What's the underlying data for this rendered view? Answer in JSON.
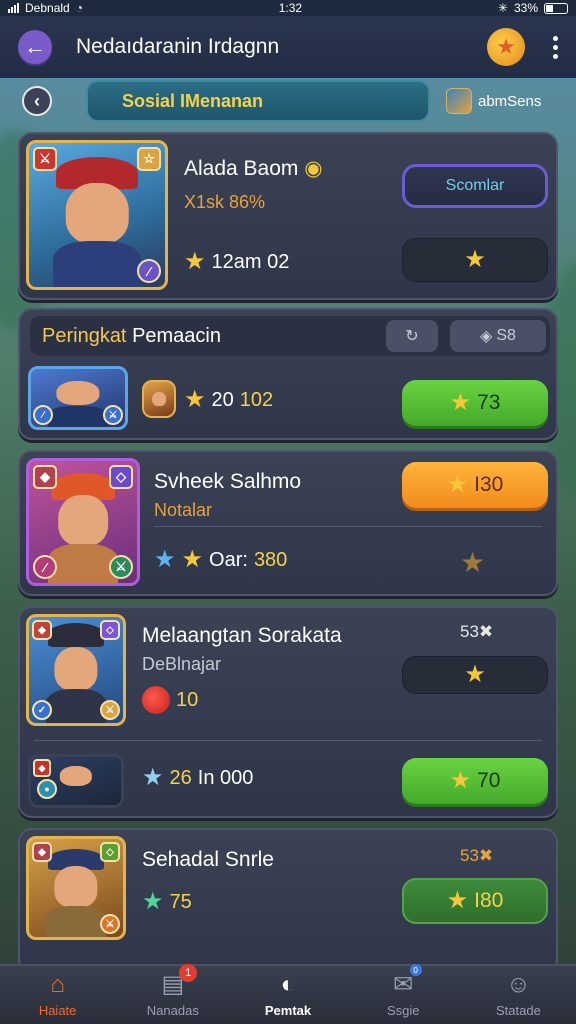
{
  "status_bar": {
    "carrier": "Debnald",
    "time": "1:32",
    "battery": "33%"
  },
  "header": {
    "title": "Nedaıdaranin Irdagnn"
  },
  "subbar": {
    "tab_label": "Sosial IMenanan",
    "user_name": "abmSens"
  },
  "profile_card": {
    "name": "Alada Baom",
    "subtitle": "X1sk 86%",
    "stat": "12am 02",
    "button_label": "Scomlar"
  },
  "ranking": {
    "title_highlight": "Peringkat",
    "title_rest": "Pemaacin",
    "chip_right": "S8",
    "row": {
      "stat_prefix": "20",
      "stat_value": "102",
      "button_value": "73"
    }
  },
  "players": [
    {
      "name": "Svheek Salhmo",
      "subtitle": "Notalar",
      "stat_prefix": "Oar:",
      "stat_value": "380",
      "button_value": "I30"
    },
    {
      "name": "Melaangtan Sorakata",
      "subtitle": "DeBlnajar",
      "badge": "53",
      "stat_value": "10",
      "row2_stat_prefix": "26",
      "row2_stat_rest": "In 000",
      "row2_button_value": "70"
    },
    {
      "name": "Sehadal Snrle",
      "badge": "53",
      "stat_value": "75",
      "button_value": "I80"
    }
  ],
  "bottom_nav": [
    {
      "label": "Haiate",
      "icon": "home-icon"
    },
    {
      "label": "Nanadas",
      "icon": "book-icon",
      "badge": "1"
    },
    {
      "label": "Pemtak",
      "icon": "compass-icon"
    },
    {
      "label": "Ssgie",
      "icon": "chat-icon",
      "badge": "0"
    },
    {
      "label": "Statade",
      "icon": "profile-icon"
    }
  ],
  "colors": {
    "header": "#222c44",
    "accent_green": "#44a92a",
    "accent_orange": "#f18c1b",
    "card": "#30364a"
  }
}
